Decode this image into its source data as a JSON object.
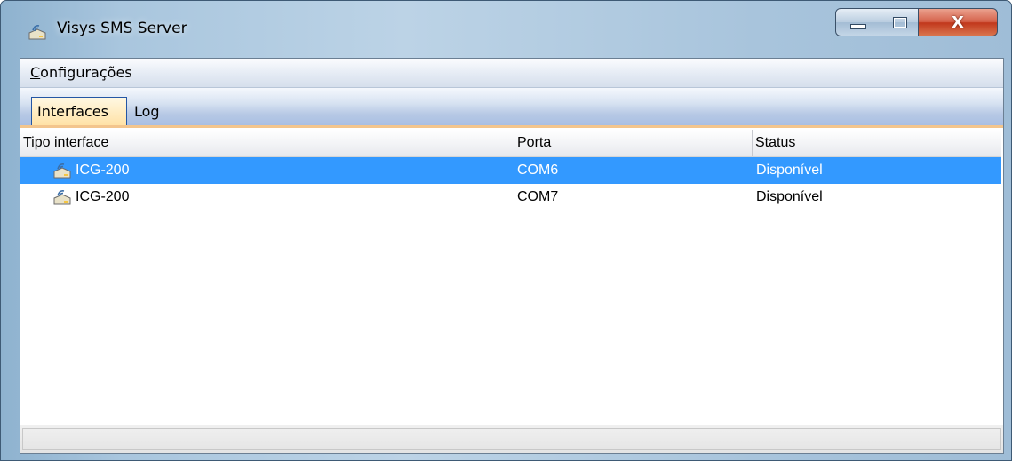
{
  "window": {
    "title": "Visys SMS Server",
    "title_icon": "modem-icon",
    "buttons": {
      "minimize_glyph": "minimize-icon",
      "maximize_glyph": "maximize-icon",
      "close_glyph": "X"
    }
  },
  "menu": {
    "items": [
      {
        "accel": "C",
        "rest": "onfigurações"
      }
    ]
  },
  "tabs": [
    {
      "label": "Interfaces",
      "active": true
    },
    {
      "label": "Log",
      "active": false
    }
  ],
  "list": {
    "columns": [
      "Tipo interface",
      "Porta",
      "Status"
    ],
    "rows": [
      {
        "icon": "modem-icon",
        "tipo": "ICG-200",
        "porta": "COM6",
        "status": "Disponível",
        "selected": true
      },
      {
        "icon": "modem-icon",
        "tipo": "ICG-200",
        "porta": "COM7",
        "status": "Disponível",
        "selected": false
      }
    ]
  },
  "colors": {
    "selection": "#3399ff",
    "active_tab": "#ffe2a6",
    "tab_underline": "#f3c58d",
    "close_button": "#c1371c"
  }
}
